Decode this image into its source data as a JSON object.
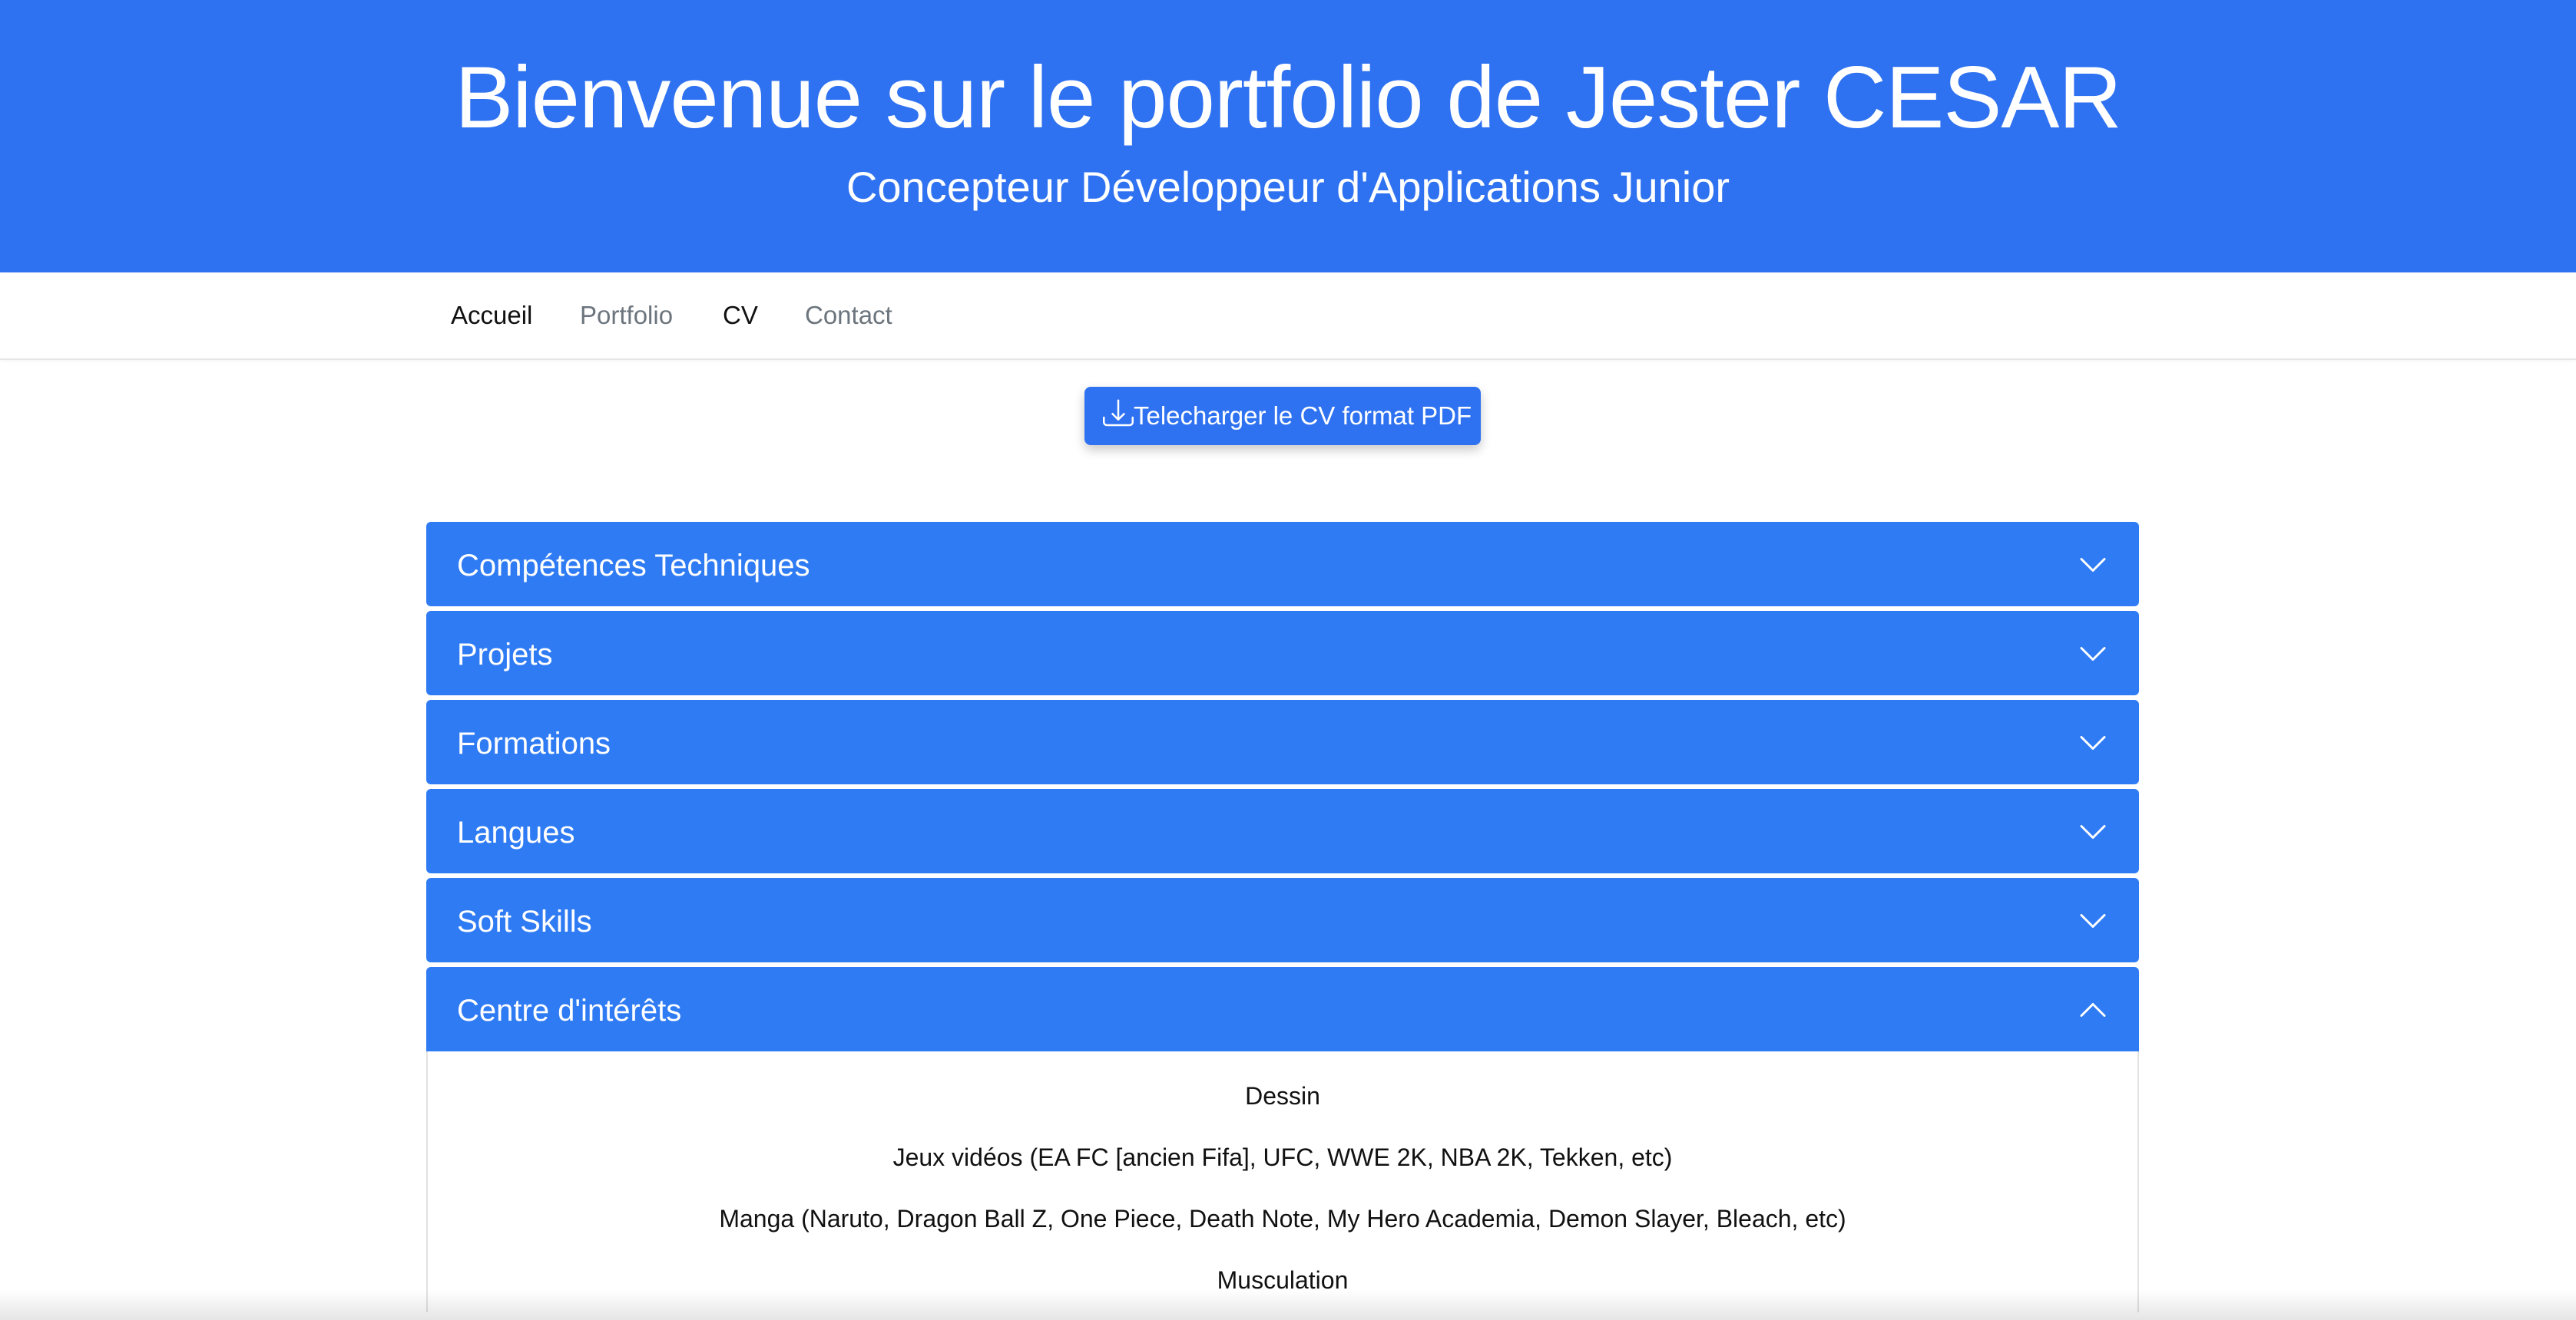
{
  "header": {
    "title": "Bienvenue sur le portfolio de Jester CESAR",
    "subtitle": "Concepteur Développeur d'Applications Junior"
  },
  "nav": {
    "items": [
      {
        "label": "Accueil"
      },
      {
        "label": "Portfolio"
      },
      {
        "label": "CV"
      },
      {
        "label": "Contact"
      }
    ]
  },
  "download": {
    "label": "Telecharger le CV format PDF",
    "icon": "download-icon"
  },
  "accordion": {
    "sections": [
      {
        "title": "Compétences Techniques",
        "expanded": false
      },
      {
        "title": "Projets",
        "expanded": false
      },
      {
        "title": "Formations",
        "expanded": false
      },
      {
        "title": "Langues",
        "expanded": false
      },
      {
        "title": "Soft Skills",
        "expanded": false
      },
      {
        "title": "Centre d'intérêts",
        "expanded": true
      }
    ],
    "interests": [
      "Dessin",
      "Jeux vidéos (EA FC [ancien Fifa], UFC, WWE 2K, NBA 2K, Tekken, etc)",
      "Manga (Naruto, Dragon Ball Z, One Piece, Death Note, My Hero Academia, Demon Slayer, Bleach, etc)",
      "Musculation"
    ]
  },
  "colors": {
    "brand_blue": "#2f72f1",
    "accordion_blue": "#2f7bf4",
    "nav_active": "#111111",
    "nav_muted": "#6c757d"
  }
}
